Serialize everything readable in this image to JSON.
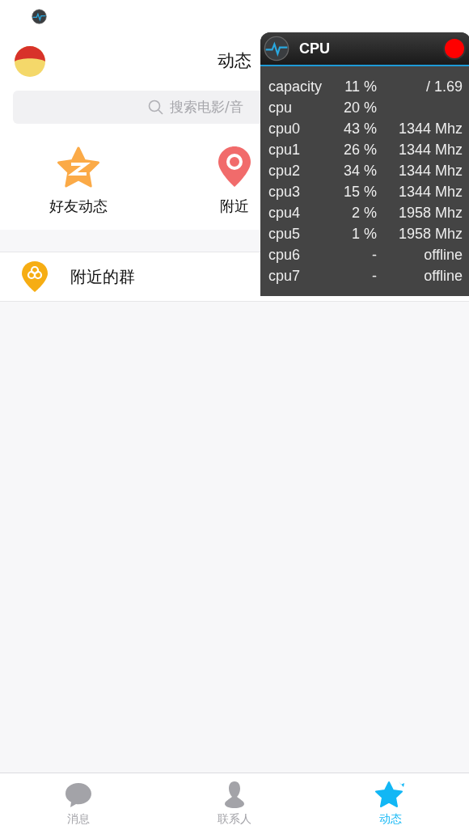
{
  "header": {
    "title": "动态"
  },
  "search": {
    "placeholder": "搜索电影/音"
  },
  "shortcuts": [
    {
      "kind": "star",
      "label": "好友动态"
    },
    {
      "kind": "pin",
      "label": "附近"
    }
  ],
  "list": [
    {
      "label": "附近的群"
    }
  ],
  "tab_bar": [
    {
      "kind": "chat",
      "label": "消息",
      "selected": false
    },
    {
      "kind": "person",
      "label": "联系人",
      "selected": false
    },
    {
      "kind": "star",
      "label": "动态",
      "selected": true
    }
  ],
  "cpu_overlay": {
    "title": "CPU",
    "rows": [
      {
        "name": "capacity",
        "percent": "11 %",
        "value": "/ 1.69"
      },
      {
        "name": "cpu",
        "percent": "20 %",
        "value": ""
      },
      {
        "name": "cpu0",
        "percent": "43 %",
        "value": "1344 Mhz"
      },
      {
        "name": "cpu1",
        "percent": "26 %",
        "value": "1344 Mhz"
      },
      {
        "name": "cpu2",
        "percent": "34 %",
        "value": "1344 Mhz"
      },
      {
        "name": "cpu3",
        "percent": "15 %",
        "value": "1344 Mhz"
      },
      {
        "name": "cpu4",
        "percent": "2 %",
        "value": "1958 Mhz"
      },
      {
        "name": "cpu5",
        "percent": "1 %",
        "value": "1958 Mhz"
      },
      {
        "name": "cpu6",
        "percent": "-",
        "value": "offline"
      },
      {
        "name": "cpu7",
        "percent": "-",
        "value": "offline"
      }
    ]
  }
}
